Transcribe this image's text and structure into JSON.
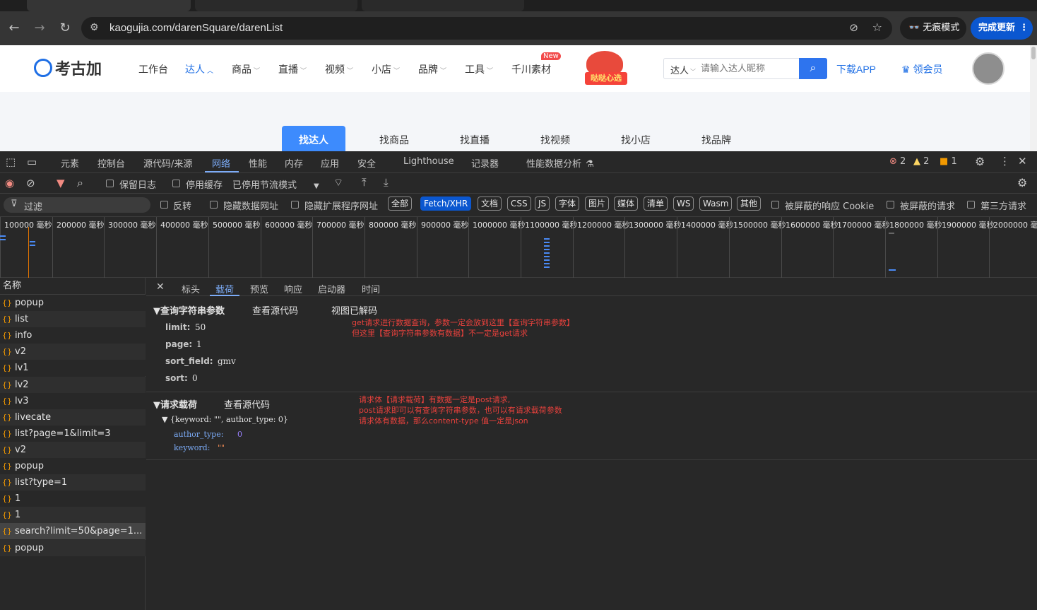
{
  "browser": {
    "url": "kaogujia.com/darenSquare/darenList",
    "incognito_label": "无痕模式",
    "update_label": "完成更新"
  },
  "site": {
    "logo_text": "考古加",
    "menu": [
      "工作台",
      "达人",
      "商品",
      "直播",
      "视频",
      "小店",
      "品牌",
      "工具",
      "千川素材"
    ],
    "new_badge": "New",
    "promo_text": "哒哒心选",
    "search_type": "达人",
    "search_placeholder": "请输入达人昵称",
    "download_label": "下载APP",
    "vip_label": "领会员",
    "subtabs": [
      "找达人",
      "找商品",
      "找直播",
      "找视频",
      "找小店",
      "找品牌"
    ]
  },
  "devtools": {
    "tabs": [
      "元素",
      "控制台",
      "源代码/来源",
      "网络",
      "性能",
      "内存",
      "应用",
      "安全",
      "Lighthouse",
      "记录器",
      "性能数据分析"
    ],
    "errors": "2",
    "warnings": "2",
    "issues": "1",
    "toolbar": {
      "preserve_log": "保留日志",
      "disable_cache": "停用缓存",
      "throttle": "已停用节流模式"
    },
    "filter": {
      "placeholder": "过滤",
      "invert": "反转",
      "hide_data_urls": "隐藏数据网址",
      "hide_ext_urls": "隐藏扩展程序网址",
      "types": [
        "全部",
        "Fetch/XHR",
        "文档",
        "CSS",
        "JS",
        "字体",
        "图片",
        "媒体",
        "清单",
        "WS",
        "Wasm",
        "其他"
      ],
      "blocked_cookies": "被屏蔽的响应 Cookie",
      "blocked_requests": "被屏蔽的请求",
      "third_party": "第三方请求"
    },
    "timeline_labels": [
      "100000 毫秒",
      "200000 毫秒",
      "300000 毫秒",
      "400000 毫秒",
      "500000 毫秒",
      "600000 毫秒",
      "700000 毫秒",
      "800000 毫秒",
      "900000 毫秒",
      "1000000 毫秒",
      "1100000 毫秒",
      "1200000 毫秒",
      "1300000 毫秒",
      "1400000 毫秒",
      "1500000 毫秒",
      "1600000 毫秒",
      "1700000 毫秒",
      "1800000 毫秒",
      "1900000 毫秒",
      "2000000 毫"
    ],
    "names_header": "名称",
    "requests": [
      "popup",
      "list",
      "info",
      "v2",
      "lv1",
      "lv2",
      "lv3",
      "livecate",
      "list?page=1&limit=3",
      "v2",
      "popup",
      "list?type=1",
      "1",
      "1",
      "search?limit=50&page=1...",
      "popup"
    ],
    "detail_tabs": [
      "标头",
      "载荷",
      "预览",
      "响应",
      "启动器",
      "时间"
    ],
    "query_section": {
      "title": "▼查询字符串参数",
      "view_source": "查看源代码",
      "view_decoded": "视图已解码",
      "params": [
        {
          "key": "limit:",
          "value": "50"
        },
        {
          "key": "page:",
          "value": "1"
        },
        {
          "key": "sort_field:",
          "value": "gmv"
        },
        {
          "key": "sort:",
          "value": "0"
        }
      ],
      "note_lines": [
        "get请求进行数据查询，参数一定会放到这里【查询字符串参数】",
        "但这里【查询字符串参数有数据】不一定是get请求"
      ]
    },
    "payload_section": {
      "title": "▼请求载荷",
      "view_source": "查看源代码",
      "summary": "▼ {keyword: \"\", author_type: 0}",
      "fields": [
        {
          "key": "author_type:",
          "value": "0"
        },
        {
          "key": "keyword:",
          "value": "\"\""
        }
      ],
      "note_lines": [
        "请求体【请求载荷】有数据一定是post请求,",
        "post请求即可以有查询字符串参数，也可以有请求载荷参数",
        "请求体有数据，那么content-type 值一定是json"
      ]
    }
  }
}
